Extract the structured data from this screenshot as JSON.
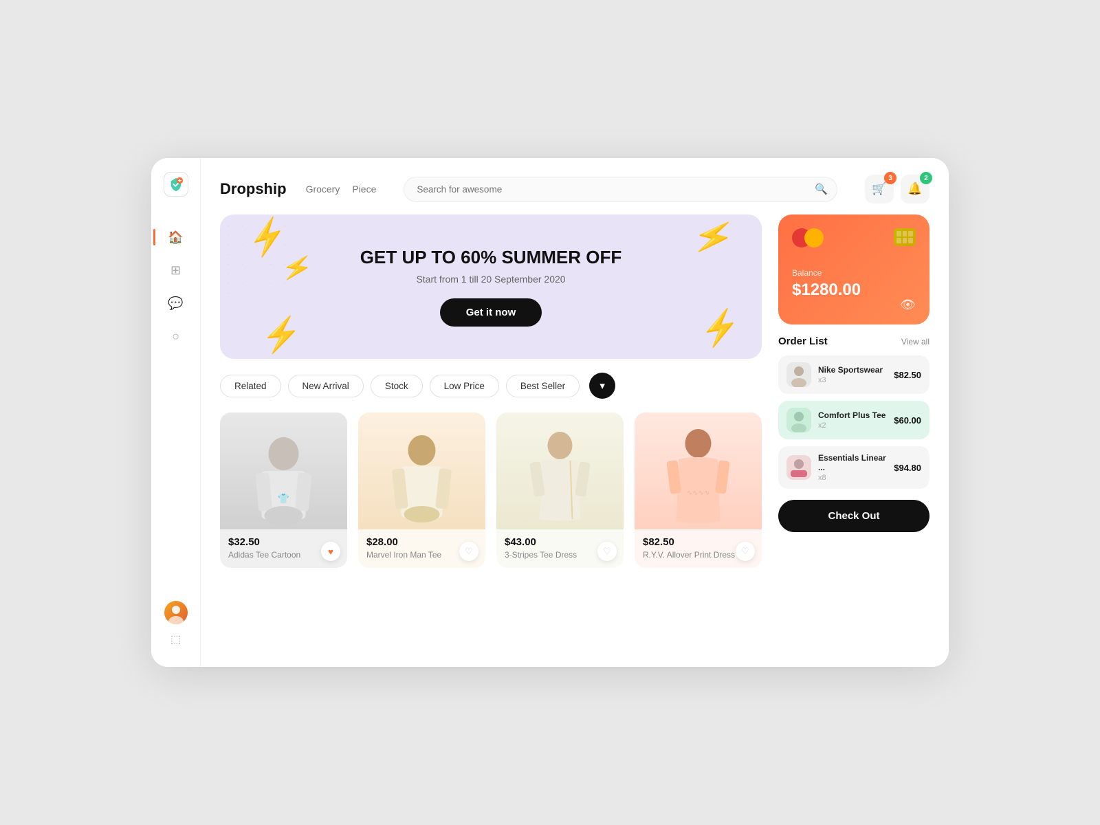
{
  "app": {
    "logo": "▶",
    "brand": "Dropship",
    "nav": [
      "Grocery",
      "Piece"
    ],
    "search_placeholder": "Search for awesome"
  },
  "header_actions": {
    "cart_badge": "3",
    "bell_badge": "2"
  },
  "banner": {
    "title": "GET UP TO 60% SUMMER OFF",
    "subtitle": "Start from 1 till 20 September 2020",
    "cta": "Get it now"
  },
  "filters": [
    {
      "label": "Related",
      "active": false
    },
    {
      "label": "New Arrival",
      "active": false
    },
    {
      "label": "Stock",
      "active": false
    },
    {
      "label": "Low Price",
      "active": false
    },
    {
      "label": "Best Seller",
      "active": false
    }
  ],
  "products": [
    {
      "price": "$32.50",
      "name": "Adidas Tee Cartoon",
      "liked": true,
      "bg": "#f0f0f0",
      "person_color": "#ccc"
    },
    {
      "price": "$28.00",
      "name": "Marvel Iron Man Tee",
      "liked": false,
      "bg": "#fdf8f0",
      "person_color": "#e8d8b0"
    },
    {
      "price": "$43.00",
      "name": "3-Stripes Tee Dress",
      "liked": false,
      "bg": "#fafaf5",
      "person_color": "#e5e0c8"
    },
    {
      "price": "$82.50",
      "name": "R.Y.V. Allover Print Dress",
      "liked": false,
      "bg": "#fff5f2",
      "person_color": "#f0c8b8"
    }
  ],
  "wallet": {
    "label": "Balance",
    "amount": "$1280.00"
  },
  "order_list": {
    "title": "Order List",
    "view_all": "View all",
    "items": [
      {
        "name": "Nike Sportswear",
        "qty": "x3",
        "price": "$82.50",
        "color": "#f0f0f0"
      },
      {
        "name": "Comfort Plus Tee",
        "qty": "x2",
        "price": "$60.00",
        "color": "#e0f5ec"
      },
      {
        "name": "Essentials Linear ...",
        "qty": "x8",
        "price": "$94.80",
        "color": "#f0f0f0"
      }
    ]
  },
  "checkout": {
    "label": "Check Out"
  },
  "sidebar": {
    "items": [
      {
        "icon": "🏠",
        "active": true
      },
      {
        "icon": "⊞",
        "active": false
      },
      {
        "icon": "💬",
        "active": false
      },
      {
        "icon": "○",
        "active": false
      }
    ]
  }
}
